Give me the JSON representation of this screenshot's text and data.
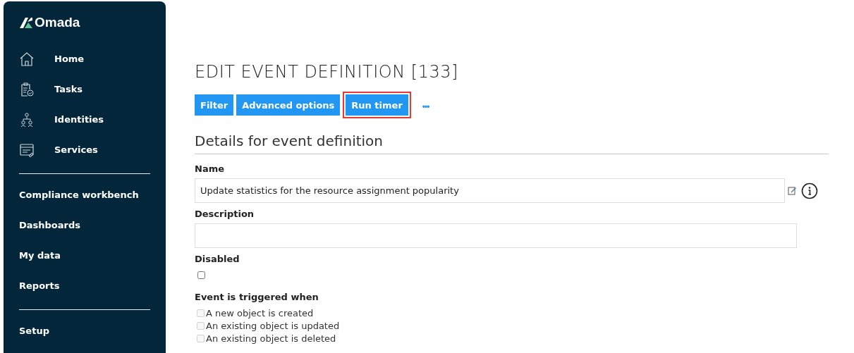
{
  "sidebar": {
    "logo": "Omada",
    "items": [
      {
        "label": "Home"
      },
      {
        "label": "Tasks"
      },
      {
        "label": "Identities"
      },
      {
        "label": "Services"
      }
    ],
    "sections": [
      [
        {
          "label": "Compliance workbench"
        },
        {
          "label": "Dashboards"
        },
        {
          "label": "My data"
        },
        {
          "label": "Reports"
        }
      ],
      [
        {
          "label": "Setup"
        }
      ]
    ]
  },
  "page": {
    "title": "EDIT EVENT DEFINITION [133]",
    "toolbar": [
      {
        "label": "Filter",
        "highlighted": false
      },
      {
        "label": "Advanced options",
        "highlighted": false
      },
      {
        "label": "Run timer",
        "highlighted": true
      }
    ],
    "more": "•••",
    "section_title": "Details for event definition",
    "name": {
      "label": "Name",
      "value": "Update statistics for the resource assignment popularity"
    },
    "description": {
      "label": "Description"
    },
    "disabled": {
      "label": "Disabled",
      "checked": false
    },
    "triggers": {
      "label": "Event is triggered when",
      "options": [
        {
          "label": "A new object is created",
          "checked": false,
          "disabled": true
        },
        {
          "label": "An existing object is updated",
          "checked": false,
          "disabled": true
        },
        {
          "label": "An existing object is deleted",
          "checked": false,
          "disabled": true
        }
      ]
    }
  }
}
